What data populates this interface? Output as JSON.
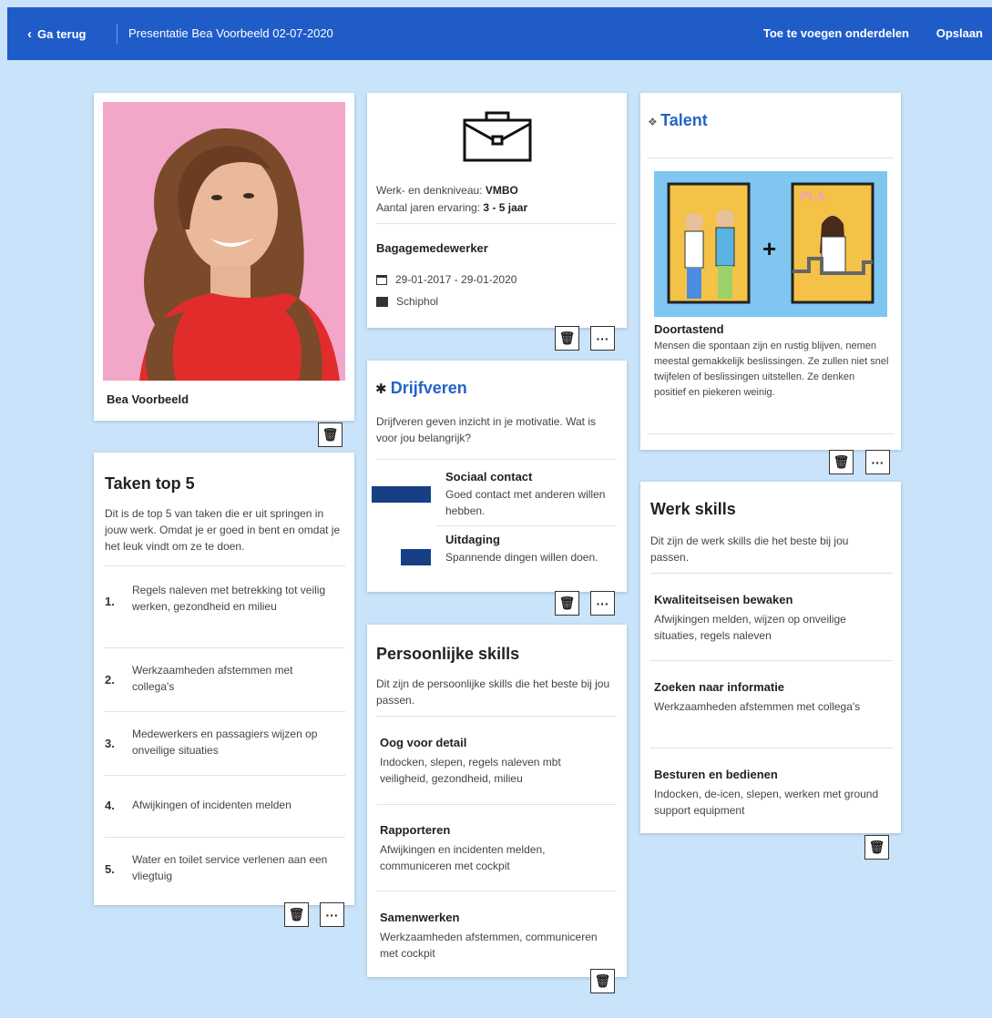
{
  "header": {
    "back_label": "Ga terug",
    "title": "Presentatie Bea Voorbeeld 02-07-2020",
    "add_label": "Toe te voegen onderdelen",
    "save_label": "Opslaan"
  },
  "profile": {
    "name": "Bea Voorbeeld"
  },
  "tasks": {
    "title": "Taken top 5",
    "intro": "Dit is de top 5 van taken die er uit springen in jouw werk. Omdat je er goed in bent en omdat je het leuk vindt om ze te doen.",
    "items": [
      {
        "num": "1.",
        "text": "Regels naleven met betrekking tot veilig werken, gezondheid en milieu"
      },
      {
        "num": "2.",
        "text": "Werkzaamheden afstemmen met collega's"
      },
      {
        "num": "3.",
        "text": "Medewerkers en passagiers wijzen op onveilige situaties"
      },
      {
        "num": "4.",
        "text": "Afwijkingen of incidenten melden"
      },
      {
        "num": "5.",
        "text": "Water en toilet service verlenen aan een vliegtuig"
      }
    ]
  },
  "work": {
    "level_label": "Werk- en denkniveau:",
    "level_value": "VMBO",
    "years_label": "Aantal jaren ervaring:",
    "years_value": "3 - 5 jaar",
    "job_title": "Bagagemedewerker",
    "period": "29-01-2017 - 29-01-2020",
    "location": "Schiphol"
  },
  "drives": {
    "title": "Drijfveren",
    "intro": "Drijfveren geven inzicht in je motivatie. Wat is voor jou belangrijk?",
    "items": [
      {
        "name": "Sociaal contact",
        "desc": "Goed contact met anderen willen hebben.",
        "level": 0.95
      },
      {
        "name": "Uitdaging",
        "desc": "Spannende dingen willen doen.",
        "level": 0.55
      }
    ]
  },
  "personal": {
    "title": "Persoonlijke skills",
    "intro": "Dit zijn de persoonlijke skills die het beste bij jou passen.",
    "items": [
      {
        "name": "Oog voor detail",
        "desc": "Indocken, slepen, regels naleven mbt veiligheid, gezondheid, milieu"
      },
      {
        "name": "Rapporteren",
        "desc": "Afwijkingen en incidenten melden, communiceren met cockpit"
      },
      {
        "name": "Samenwerken",
        "desc": "Werkzaamheden afstemmen, communiceren met cockpit"
      }
    ]
  },
  "talent": {
    "title": "Talent",
    "name": "Doortastend",
    "desc": "Mensen die spontaan zijn en rustig blijven, nemen meestal gemakkelijk beslissingen. Ze zullen niet snel twijfelen of beslissingen uitstellen. Ze denken positief en piekeren weinig."
  },
  "workskills": {
    "title": "Werk skills",
    "intro": "Dit zijn de werk skills die het beste bij jou passen.",
    "items": [
      {
        "name": "Kwaliteitseisen bewaken",
        "desc": "Afwijkingen melden, wijzen op onveilige situaties, regels naleven"
      },
      {
        "name": "Zoeken naar informatie",
        "desc": "Werkzaamheden afstemmen met collega's"
      },
      {
        "name": "Besturen en bedienen",
        "desc": "Indocken, de-icen, slepen, werken met ground support equipment"
      }
    ]
  },
  "icons": {
    "trash": "trash-icon",
    "more": "more-icon",
    "calendar": "calendar-icon",
    "building": "building-icon",
    "briefcase": "briefcase-icon"
  },
  "colors": {
    "header": "#1f5cc8",
    "background": "#c9e3fb",
    "accent": "#2463c7",
    "bar": "#183f86"
  }
}
